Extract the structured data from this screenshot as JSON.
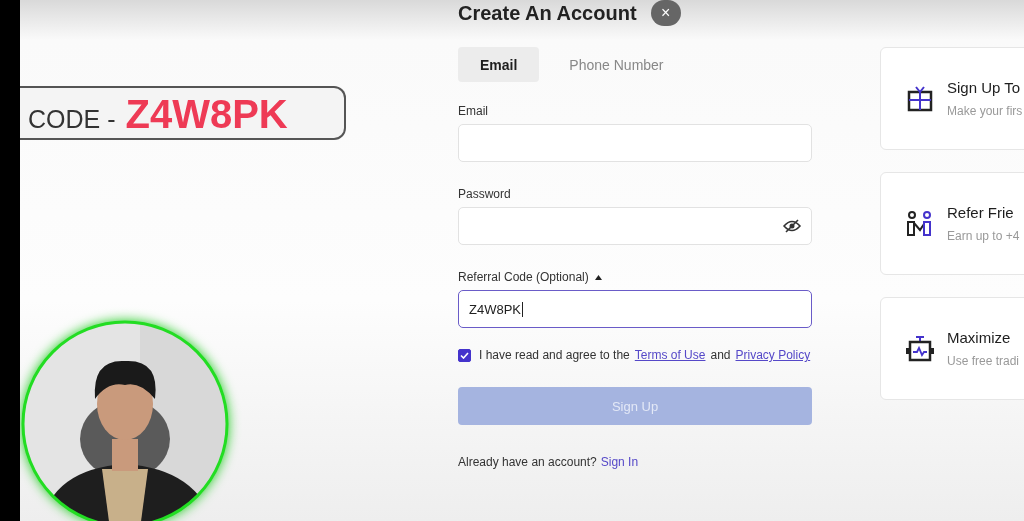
{
  "header": {
    "title": "Create An Account",
    "close": "×"
  },
  "promo": {
    "label": "CODE -",
    "code": "Z4W8PK"
  },
  "tabs": [
    {
      "label": "Email",
      "selected": true
    },
    {
      "label": "Phone Number",
      "selected": false
    }
  ],
  "fields": [
    {
      "kind": "text",
      "label": "Email"
    },
    {
      "kind": "password",
      "label": "Password"
    },
    {
      "kind": "referral",
      "label": "Referral Code (Optional)",
      "expanded": true,
      "focused": true,
      "value": "Z4W8PK"
    }
  ],
  "agreement": {
    "checked": true,
    "text": "I have read and agree to the",
    "links": [
      "Terms of Use",
      "Privacy Policy"
    ],
    "joiner": "and"
  },
  "submit": {
    "label": "Sign Up",
    "disabled": true
  },
  "signin": {
    "text": "Already have an account?",
    "link": "Sign In"
  },
  "cards": [
    {
      "kind": "gift",
      "title": "Sign Up To",
      "subtitle": "Make your firs"
    },
    {
      "kind": "friends",
      "title": "Refer Frie",
      "subtitle": "Earn up to +4"
    },
    {
      "kind": "bot",
      "title": "Maximize",
      "subtitle": "Use free tradi"
    }
  ]
}
